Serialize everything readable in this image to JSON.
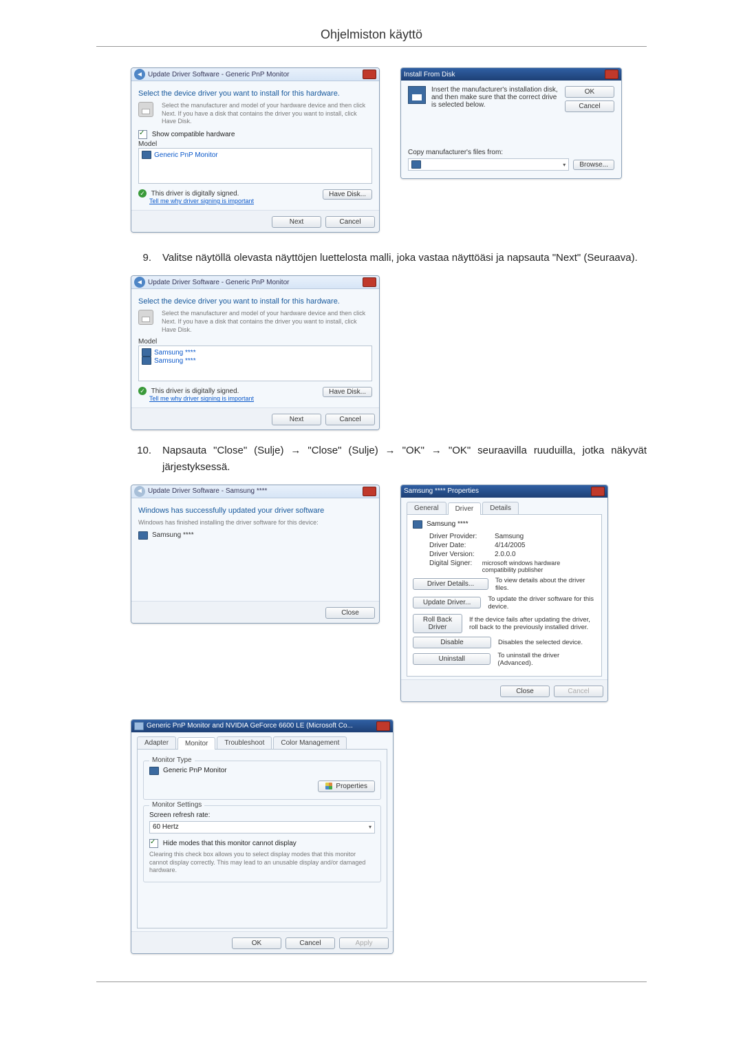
{
  "doc": {
    "title": "Ohjelmiston käyttö"
  },
  "steps": {
    "nine": {
      "num": "9.",
      "text": "Valitse näytöllä olevasta näyttöjen luettelosta malli, joka vastaa näyttöäsi ja napsauta \"Next\" (Seuraava)."
    },
    "ten": {
      "num": "10.",
      "text": "Napsauta \"Close\" (Sulje) → \"Close\" (Sulje) → \"OK\" → \"OK\" seuraavilla ruuduilla, jotka näkyvät järjestyksessä."
    }
  },
  "dlg_select_generic": {
    "breadcrumb": "Update Driver Software - Generic PnP Monitor",
    "heading": "Select the device driver you want to install for this hardware.",
    "hint": "Select the manufacturer and model of your hardware device and then click Next. If you have a disk that contains the driver you want to install, click Have Disk.",
    "show_compatible": "Show compatible hardware",
    "model_label": "Model",
    "model_item": "Generic PnP Monitor",
    "signed": "This driver is digitally signed.",
    "signed_link": "Tell me why driver signing is important",
    "have_disk": "Have Disk...",
    "next": "Next",
    "cancel": "Cancel"
  },
  "dlg_install_from_disk": {
    "title": "Install From Disk",
    "msg": "Insert the manufacturer's installation disk, and then make sure that the correct drive is selected below.",
    "ok": "OK",
    "cancel": "Cancel",
    "copy_label": "Copy manufacturer's files from:",
    "browse": "Browse..."
  },
  "dlg_select_samsung": {
    "breadcrumb": "Update Driver Software - Generic PnP Monitor",
    "heading": "Select the device driver you want to install for this hardware.",
    "hint": "Select the manufacturer and model of your hardware device and then click Next. If you have a disk that contains the driver you want to install, click Have Disk.",
    "model_label": "Model",
    "model_item1": "Samsung ****",
    "model_item2": "Samsung ****",
    "signed": "This driver is digitally signed.",
    "signed_link": "Tell me why driver signing is important",
    "have_disk": "Have Disk...",
    "next": "Next",
    "cancel": "Cancel"
  },
  "dlg_update_done": {
    "breadcrumb": "Update Driver Software - Samsung ****",
    "heading": "Windows has successfully updated your driver software",
    "line": "Windows has finished installing the driver software for this device:",
    "device": "Samsung ****",
    "close": "Close"
  },
  "dlg_properties": {
    "title": "Samsung **** Properties",
    "tab_general": "General",
    "tab_driver": "Driver",
    "tab_details": "Details",
    "device": "Samsung ****",
    "provider_k": "Driver Provider:",
    "provider_v": "Samsung",
    "date_k": "Driver Date:",
    "date_v": "4/14/2005",
    "version_k": "Driver Version:",
    "version_v": "2.0.0.0",
    "signer_k": "Digital Signer:",
    "signer_v": "microsoft windows hardware compatibility publisher",
    "btn_details": "Driver Details...",
    "btn_details_txt": "To view details about the driver files.",
    "btn_update": "Update Driver...",
    "btn_update_txt": "To update the driver software for this device.",
    "btn_rollback": "Roll Back Driver",
    "btn_rollback_txt": "If the device fails after updating the driver, roll back to the previously installed driver.",
    "btn_disable": "Disable",
    "btn_disable_txt": "Disables the selected device.",
    "btn_uninstall": "Uninstall",
    "btn_uninstall_txt": "To uninstall the driver (Advanced).",
    "close": "Close",
    "cancel": "Cancel"
  },
  "dlg_monitor_tab": {
    "title": "Generic PnP Monitor and NVIDIA GeForce 6600 LE (Microsoft Co...",
    "tab_adapter": "Adapter",
    "tab_monitor": "Monitor",
    "tab_trouble": "Troubleshoot",
    "tab_color": "Color Management",
    "group_type": "Monitor Type",
    "type_name": "Generic PnP Monitor",
    "properties": "Properties",
    "group_settings": "Monitor Settings",
    "refresh_label": "Screen refresh rate:",
    "refresh_value": "60 Hertz",
    "hide_modes": "Hide modes that this monitor cannot display",
    "hide_modes_desc": "Clearing this check box allows you to select display modes that this monitor cannot display correctly. This may lead to an unusable display and/or damaged hardware.",
    "ok": "OK",
    "cancel": "Cancel",
    "apply": "Apply"
  }
}
